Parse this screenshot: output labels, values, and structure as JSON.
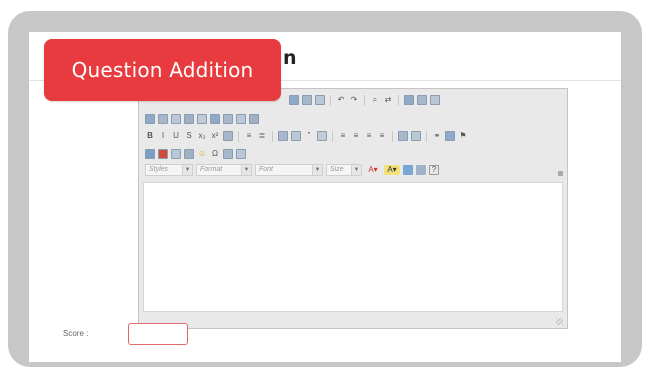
{
  "badge": {
    "label": "Question Addition",
    "color": "#e83b3f"
  },
  "heading": {
    "tail_text": "n"
  },
  "editor": {
    "toolbar_rows": [
      [
        "clipboard-icon",
        "paste-text-icon",
        "paste-word-icon",
        "sep",
        "undo-icon",
        "redo-icon",
        "sep",
        "find-icon",
        "replace-icon",
        "sep",
        "select-all-icon",
        "spellcheck-icon",
        "spellcheck-menu-icon"
      ],
      [
        "form-icon",
        "checkbox-icon",
        "radio-icon",
        "textfield-icon",
        "textarea-icon",
        "select-icon",
        "button-icon",
        "imagebutton-icon",
        "hiddenfield-icon"
      ],
      [
        "bold-icon",
        "italic-icon",
        "underline-icon",
        "strike-icon",
        "subscript-icon",
        "superscript-icon",
        "removeformat-icon",
        "sep",
        "numbered-list-icon",
        "bulleted-list-icon",
        "sep",
        "outdent-icon",
        "indent-icon",
        "blockquote-icon",
        "creatediv-icon",
        "sep",
        "align-left-icon",
        "align-center-icon",
        "align-right-icon",
        "align-justify-icon",
        "sep",
        "ltr-icon",
        "rtl-icon",
        "sep",
        "link-icon",
        "unlink-icon",
        "anchor-icon"
      ],
      [
        "image-icon",
        "flash-icon",
        "table-icon",
        "hr-icon",
        "smiley-icon",
        "specialchar-icon",
        "pagebreak-icon",
        "iframe-icon"
      ]
    ],
    "combos": [
      {
        "label": "Styles"
      },
      {
        "label": "Format"
      },
      {
        "label": "Font"
      },
      {
        "label": "Size"
      }
    ],
    "color_buttons": [
      "text-color-icon",
      "bg-color-icon"
    ],
    "extra_buttons": [
      "maximize-icon",
      "showblocks-icon",
      "about-icon"
    ]
  },
  "score": {
    "label": "Score :",
    "value": ""
  }
}
